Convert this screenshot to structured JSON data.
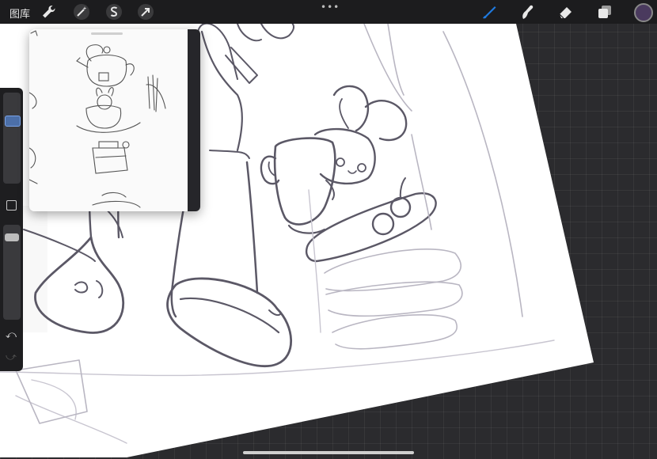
{
  "topbar": {
    "gallery_label": "图库",
    "more_label": "•••",
    "current_color": "#4a3a5e",
    "accent_color": "#1f7ae0"
  },
  "toolbar_left": [
    "wrench-icon",
    "magic-wand-icon",
    "selection-s-icon",
    "transform-arrow-icon"
  ],
  "toolbar_right": [
    "brush-icon",
    "smudge-icon",
    "eraser-icon",
    "layers-icon"
  ],
  "sidebar": {
    "brush_size_level": 0.72,
    "opacity_level": 0.9,
    "undo_label": "⤺",
    "redo_label": "⤻"
  }
}
